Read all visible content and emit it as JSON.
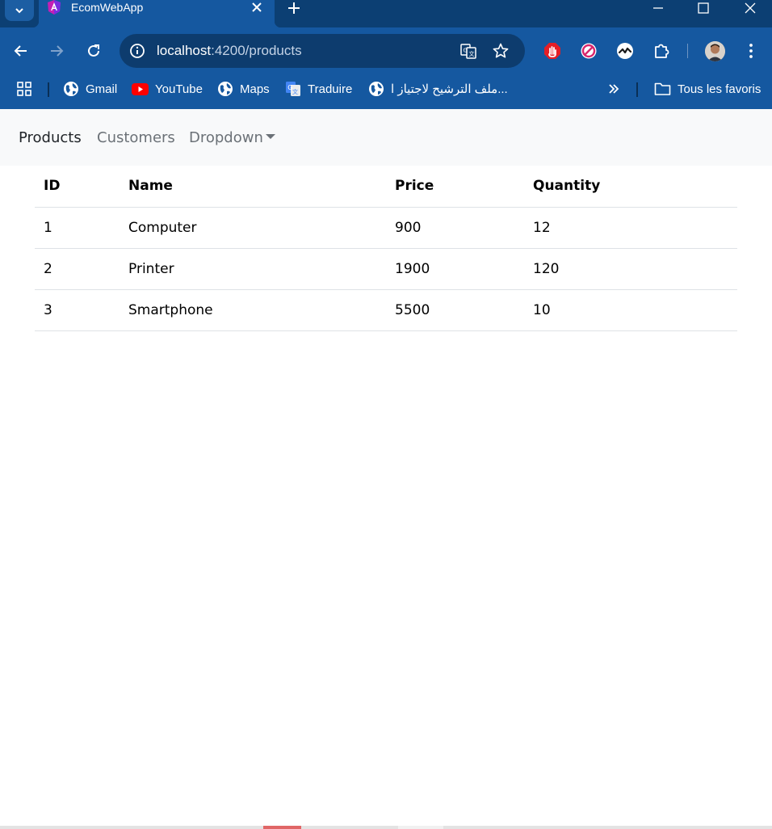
{
  "browser": {
    "tab": {
      "title": "EcomWebApp"
    },
    "url": {
      "host": "localhost",
      "path": ":4200/products"
    },
    "bookmarks": [
      {
        "label": "Gmail",
        "icon": "globe-icon"
      },
      {
        "label": "YouTube",
        "icon": "youtube-icon"
      },
      {
        "label": "Maps",
        "icon": "globe-icon"
      },
      {
        "label": "Traduire",
        "icon": "google-translate-icon"
      },
      {
        "label": "ملف الترشيح لاجتياز ا...",
        "icon": "globe-icon"
      }
    ],
    "all_bookmarks_label": "Tous les favoris",
    "colors": {
      "tabstrip": "#0c3f73",
      "toolbar": "#1558a0",
      "omnibox": "#0d3c6e"
    }
  },
  "navbar": {
    "links": [
      {
        "label": "Products",
        "active": true
      },
      {
        "label": "Customers",
        "active": false
      },
      {
        "label": "Dropdown",
        "active": false
      }
    ]
  },
  "table": {
    "headers": [
      "ID",
      "Name",
      "Price",
      "Quantity"
    ],
    "rows": [
      [
        "1",
        "Computer",
        "900",
        "12"
      ],
      [
        "2",
        "Printer",
        "1900",
        "120"
      ],
      [
        "3",
        "Smartphone",
        "5500",
        "10"
      ]
    ]
  }
}
